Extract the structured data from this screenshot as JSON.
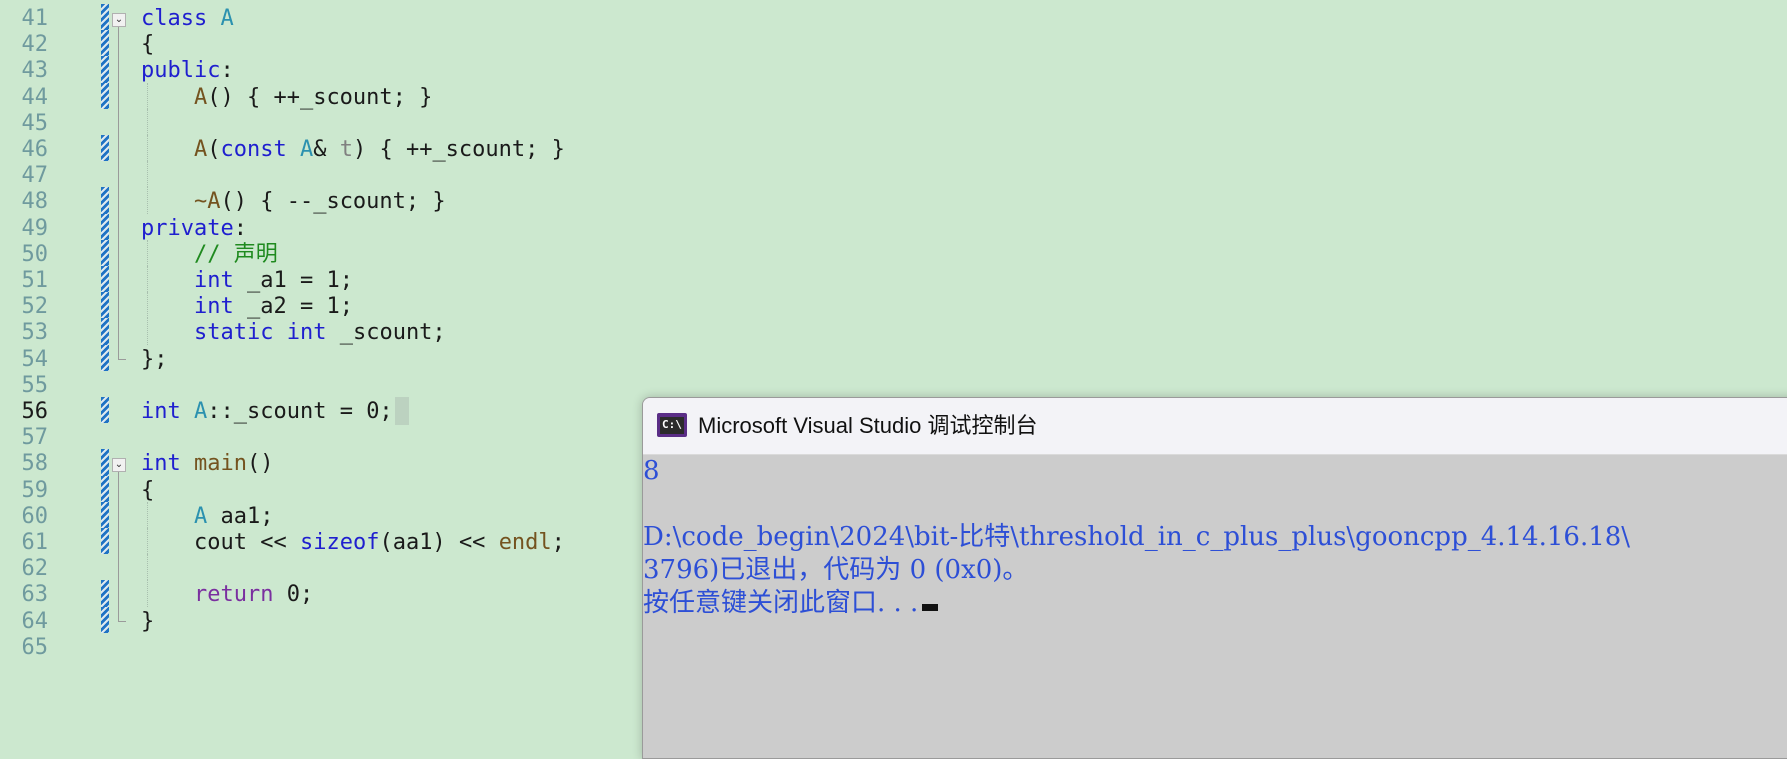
{
  "editor": {
    "lines": [
      {
        "n": "41",
        "tokens": [
          [
            "kw",
            "class"
          ],
          [
            "t",
            " "
          ],
          [
            "ty",
            "A"
          ]
        ]
      },
      {
        "n": "42",
        "tokens": [
          [
            "t",
            "{"
          ]
        ]
      },
      {
        "n": "43",
        "tokens": [
          [
            "kw",
            "public"
          ],
          [
            "t",
            ":"
          ]
        ]
      },
      {
        "n": "44",
        "tokens": [
          [
            "t",
            "    "
          ],
          [
            "fn",
            "A"
          ],
          [
            "t",
            "() { ++_scount; }"
          ]
        ]
      },
      {
        "n": "45",
        "tokens": []
      },
      {
        "n": "46",
        "tokens": [
          [
            "t",
            "    "
          ],
          [
            "fn",
            "A"
          ],
          [
            "t",
            "("
          ],
          [
            "kw",
            "const"
          ],
          [
            "t",
            " "
          ],
          [
            "ty",
            "A"
          ],
          [
            "t",
            "& "
          ],
          [
            "pa",
            "t"
          ],
          [
            "t",
            ") { ++_scount; }"
          ]
        ]
      },
      {
        "n": "47",
        "tokens": []
      },
      {
        "n": "48",
        "tokens": [
          [
            "t",
            "    "
          ],
          [
            "fn",
            "~A"
          ],
          [
            "t",
            "() { --_scount; }"
          ]
        ]
      },
      {
        "n": "49",
        "tokens": [
          [
            "kw",
            "private"
          ],
          [
            "t",
            ":"
          ]
        ]
      },
      {
        "n": "50",
        "tokens": [
          [
            "t",
            "    "
          ],
          [
            "cm",
            "// 声明"
          ]
        ]
      },
      {
        "n": "51",
        "tokens": [
          [
            "t",
            "    "
          ],
          [
            "kw",
            "int"
          ],
          [
            "t",
            " _a1 = 1;"
          ]
        ]
      },
      {
        "n": "52",
        "tokens": [
          [
            "t",
            "    "
          ],
          [
            "kw",
            "int"
          ],
          [
            "t",
            " _a2 = 1;"
          ]
        ]
      },
      {
        "n": "53",
        "tokens": [
          [
            "t",
            "    "
          ],
          [
            "kw",
            "static"
          ],
          [
            "t",
            " "
          ],
          [
            "kw",
            "int"
          ],
          [
            "t",
            " _scount;"
          ]
        ]
      },
      {
        "n": "54",
        "tokens": [
          [
            "t",
            "};"
          ]
        ]
      },
      {
        "n": "55",
        "tokens": []
      },
      {
        "n": "56",
        "tokens": [
          [
            "kw",
            "int"
          ],
          [
            "t",
            " "
          ],
          [
            "ty",
            "A"
          ],
          [
            "t",
            "::_scount = 0;"
          ]
        ]
      },
      {
        "n": "57",
        "tokens": []
      },
      {
        "n": "58",
        "tokens": [
          [
            "kw",
            "int"
          ],
          [
            "t",
            " "
          ],
          [
            "fn",
            "main"
          ],
          [
            "t",
            "()"
          ]
        ]
      },
      {
        "n": "59",
        "tokens": [
          [
            "t",
            "{"
          ]
        ]
      },
      {
        "n": "60",
        "tokens": [
          [
            "t",
            "    "
          ],
          [
            "ty",
            "A"
          ],
          [
            "t",
            " aa1;"
          ]
        ]
      },
      {
        "n": "61",
        "tokens": [
          [
            "t",
            "    cout "
          ],
          [
            "t",
            "<< "
          ],
          [
            "kw",
            "sizeof"
          ],
          [
            "t",
            "(aa1) "
          ],
          [
            "t",
            "<< "
          ],
          [
            "fn",
            "endl"
          ],
          [
            "t",
            ";"
          ]
        ]
      },
      {
        "n": "62",
        "tokens": []
      },
      {
        "n": "63",
        "tokens": [
          [
            "t",
            "    "
          ],
          [
            "pu",
            "return"
          ],
          [
            "t",
            " 0;"
          ]
        ]
      },
      {
        "n": "64",
        "tokens": [
          [
            "t",
            "}"
          ]
        ]
      },
      {
        "n": "65",
        "tokens": []
      }
    ],
    "current_line": "56",
    "changed_lines": [
      "41",
      "42",
      "43",
      "44",
      "46",
      "48",
      "49",
      "50",
      "51",
      "52",
      "53",
      "54",
      "56",
      "58",
      "59",
      "60",
      "61",
      "63",
      "64"
    ],
    "fold_markers": [
      "41",
      "58"
    ],
    "fold_ends": [
      "54",
      "64"
    ],
    "indented_lines": [
      "44",
      "45",
      "46",
      "47",
      "48",
      "50",
      "51",
      "52",
      "53",
      "60",
      "61",
      "62",
      "63"
    ],
    "colors": {
      "background": "#cce8cf",
      "keyword": "#1f1fcf",
      "type": "#2b91af",
      "function": "#74531f",
      "comment": "#1f8a1f",
      "control": "#7a2f9f",
      "line_number": "#6f9a9e"
    }
  },
  "console": {
    "title": "Microsoft Visual Studio 调试控制台",
    "icon": "console-app-icon",
    "icon_text": "C:\\",
    "lines": [
      "8",
      "",
      "D:\\code_begin\\2024\\bit-比特\\threshold_in_c_plus_plus\\gooncpp_4.14.16.18\\",
      "3796)已退出，代码为 0 (0x0)。",
      "按任意键关闭此窗口. . ."
    ],
    "colors": {
      "background": "#cccccc",
      "text": "#2d4fd6",
      "titlebar": "#f3f3f7"
    }
  }
}
